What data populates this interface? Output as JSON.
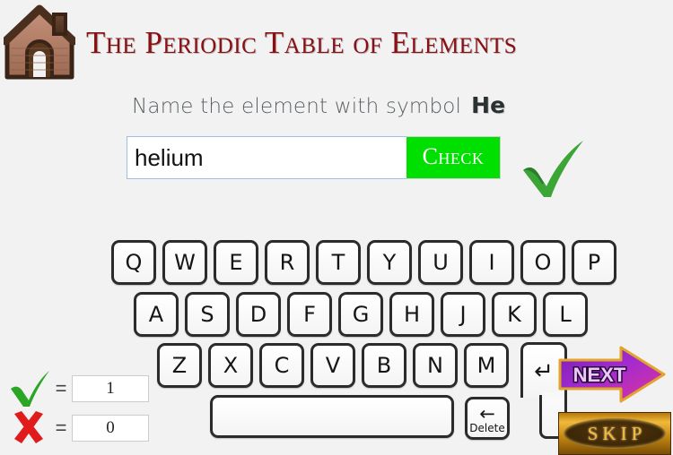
{
  "header": {
    "title": "The Periodic Table of Elements",
    "home_icon": "home-icon",
    "title_color": "#8a0f12"
  },
  "question": {
    "prompt": "Name the element with symbol",
    "symbol": "He"
  },
  "answer": {
    "value": "helium",
    "placeholder": "",
    "check_label": "Check",
    "check_color": "#00e000",
    "feedback_icon": "green-check-icon",
    "feedback_color": "#3ba536"
  },
  "keyboard": {
    "row1": [
      "Q",
      "W",
      "E",
      "R",
      "T",
      "Y",
      "U",
      "I",
      "O",
      "P"
    ],
    "row2": [
      "A",
      "S",
      "D",
      "F",
      "G",
      "H",
      "J",
      "K",
      "L"
    ],
    "row3": [
      "Z",
      "X",
      "C",
      "V",
      "B",
      "N",
      "M"
    ],
    "enter_label": "↵",
    "space_label": "",
    "delete_arrow": "←",
    "delete_label": "Delete"
  },
  "score": {
    "correct_icon": "green-check-icon",
    "correct_equals": "=",
    "correct_value": "1",
    "wrong_icon": "red-cross-icon",
    "wrong_equals": "=",
    "wrong_value": "0",
    "correct_color": "#2aa524",
    "wrong_color": "#e01b1b"
  },
  "actions": {
    "next_label": "NEXT",
    "next_color": "#a02bd0",
    "skip_label": "SKIP",
    "skip_color": "#f2b93f"
  }
}
